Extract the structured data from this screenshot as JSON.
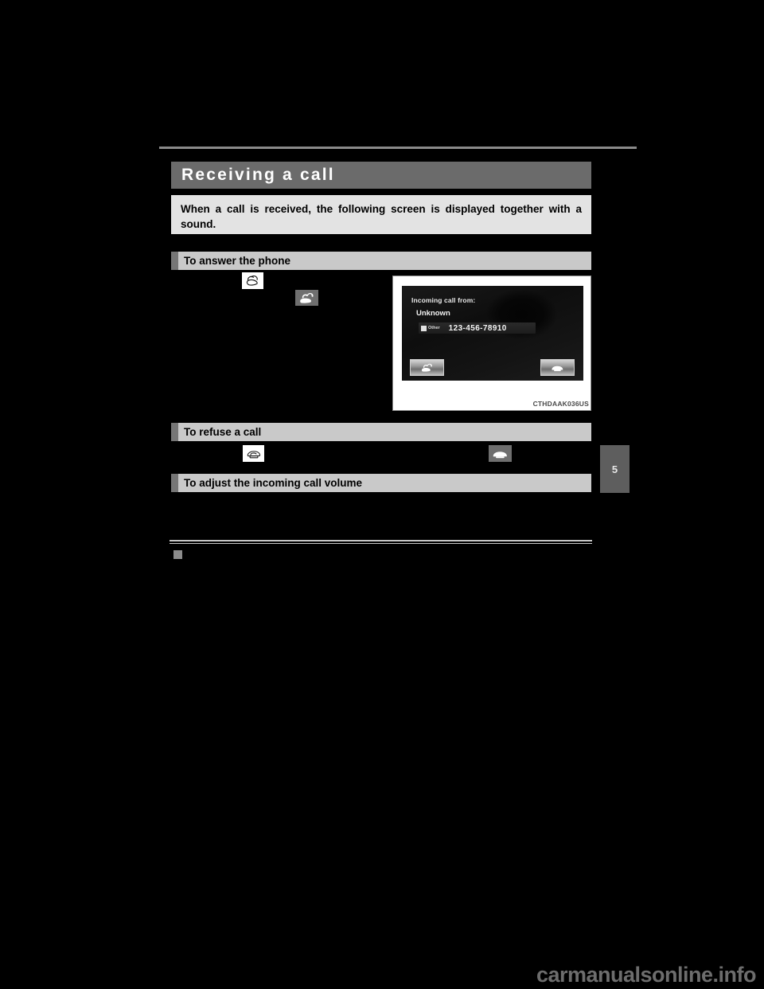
{
  "document": {
    "title": "Receiving a call",
    "page_tab_number": "5",
    "intro_text": "When a call is received, the following screen is displayed together with a sound.",
    "watermark": "carmanualsonline.info"
  },
  "sections": [
    {
      "id": "answer",
      "heading": "To answer the phone"
    },
    {
      "id": "refuse",
      "heading": "To refuse a call"
    },
    {
      "id": "volume",
      "heading": "To adjust the incoming call volume"
    }
  ],
  "icons": {
    "answer_steering": "phone-offhook-icon",
    "answer_button": "phone-answer-button-icon",
    "refuse_steering": "phone-onhook-icon",
    "refuse_button": "phone-hangup-button-icon"
  },
  "figure": {
    "caption": "CTHDAAK036US",
    "screen": {
      "prompt": "Incoming call from:",
      "caller_name": "Unknown",
      "number_label": "Other",
      "number": "123-456-78910",
      "answer_button_icon": "phone-answer-icon",
      "hangup_button_icon": "phone-hangup-icon"
    }
  },
  "colors": {
    "page_background": "#000000",
    "title_band": "#6b6b6b",
    "intro_box": "#e3e3e3",
    "section_header": "#c9c9c9",
    "section_accent": "#767676",
    "page_tab": "#5e5e5e",
    "rule": "#8a8a8a",
    "watermark": "#6d6d6d"
  }
}
